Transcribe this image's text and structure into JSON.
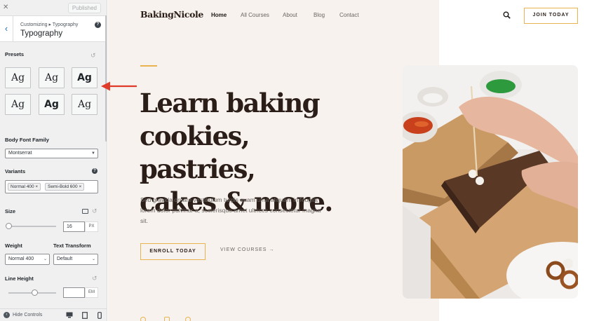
{
  "customizer": {
    "published_label": "Published",
    "breadcrumb": "Customizing ▸ Typography",
    "section_title": "Typography",
    "presets_label": "Presets",
    "preset_glyph": "Ag",
    "body_font_label": "Body Font Family",
    "body_font_value": "Montserrat",
    "variants_label": "Variants",
    "variant_tags": [
      "Normal 400",
      "Semi-Bold 600"
    ],
    "size_label": "Size",
    "size_value": "16",
    "size_unit": "PX",
    "weight_label": "Weight",
    "weight_value": "Normal 400",
    "transform_label": "Text Transform",
    "transform_value": "Default",
    "line_height_label": "Line Height",
    "line_height_unit": "EM",
    "hide_controls_label": "Hide Controls"
  },
  "site": {
    "logo": "BakingNicole",
    "nav": [
      "Home",
      "All Courses",
      "About",
      "Blog",
      "Contact"
    ],
    "join_label": "JOIN TODAY",
    "hero_title_lines": [
      "Learn baking",
      "cookies, pastries,",
      "cakes & more."
    ],
    "hero_text": "Sed gravida ornare vestibulum turpis quam urna aliquam in feugiat lorem dolor pulvinar a, scelerisque amet ultrices consectetur magna sit.",
    "enroll_label": "ENROLL TODAY",
    "view_courses_label": "VIEW COURSES →"
  },
  "colors": {
    "accent": "#e9b350",
    "heading": "#2b1d17",
    "hero_bg": "#f7f2ee",
    "annotation_arrow": "#e03a2b"
  }
}
